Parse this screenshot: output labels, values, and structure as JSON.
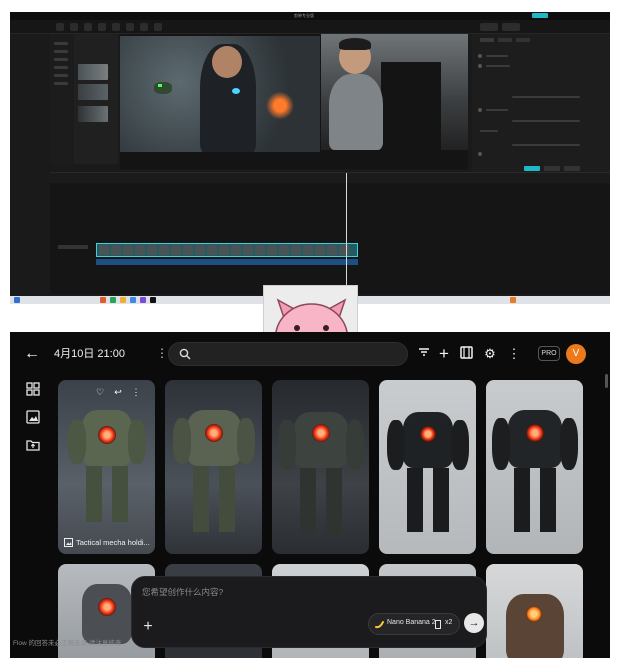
{
  "editor": {
    "app_title": "剪映专业版",
    "export_color": "#1fb8c9",
    "timeline_color": "#235b63"
  },
  "flow": {
    "header": {
      "title": "4月10日 21:00",
      "pro_badge": "PRO",
      "avatar_initial": "V",
      "avatar_color": "#ec7a1b"
    },
    "search": {
      "placeholder": ""
    },
    "toolbar": [
      "filter-icon",
      "add-icon",
      "film-icon",
      "settings-icon",
      "more-icon"
    ],
    "sidebar": [
      "grid-icon",
      "image-icon",
      "folder-upload-icon"
    ],
    "cards": [
      {
        "label": "Tactical mecha holdi..."
      }
    ],
    "composer": {
      "placeholder": "您希望创作什么内容?",
      "model": "Nano Banana 2",
      "count": "x2"
    },
    "footer": "Flow 的回答未必正确无误,请注意核查"
  }
}
